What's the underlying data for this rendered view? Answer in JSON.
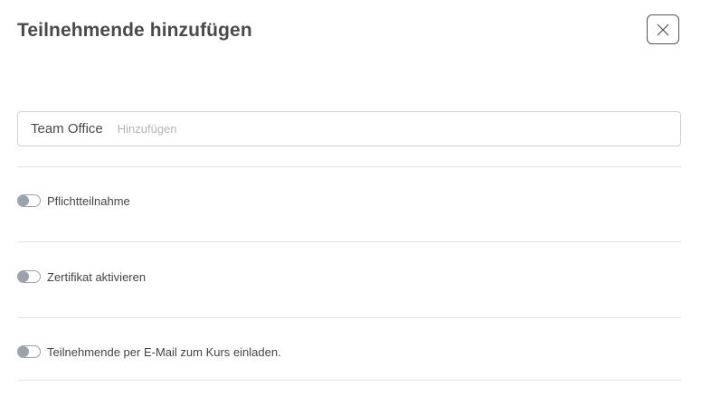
{
  "dialog": {
    "title": "Teilnehmende hinzufügen",
    "close_icon": "close-icon"
  },
  "participants": {
    "chip_label": "Team Office",
    "input_placeholder": "Hinzufügen",
    "input_value": ""
  },
  "options": [
    {
      "label": "Pflichtteilnahme",
      "enabled": false
    },
    {
      "label": "Zertifikat aktivieren",
      "enabled": false
    },
    {
      "label": "Teilnehmende per E-Mail zum Kurs einladen.",
      "enabled": false
    }
  ],
  "colors": {
    "title": "#4a4a4a",
    "toggle_knob": "#9aa2ad",
    "divider": "#e2e2e2",
    "placeholder": "#b5b5b5"
  }
}
